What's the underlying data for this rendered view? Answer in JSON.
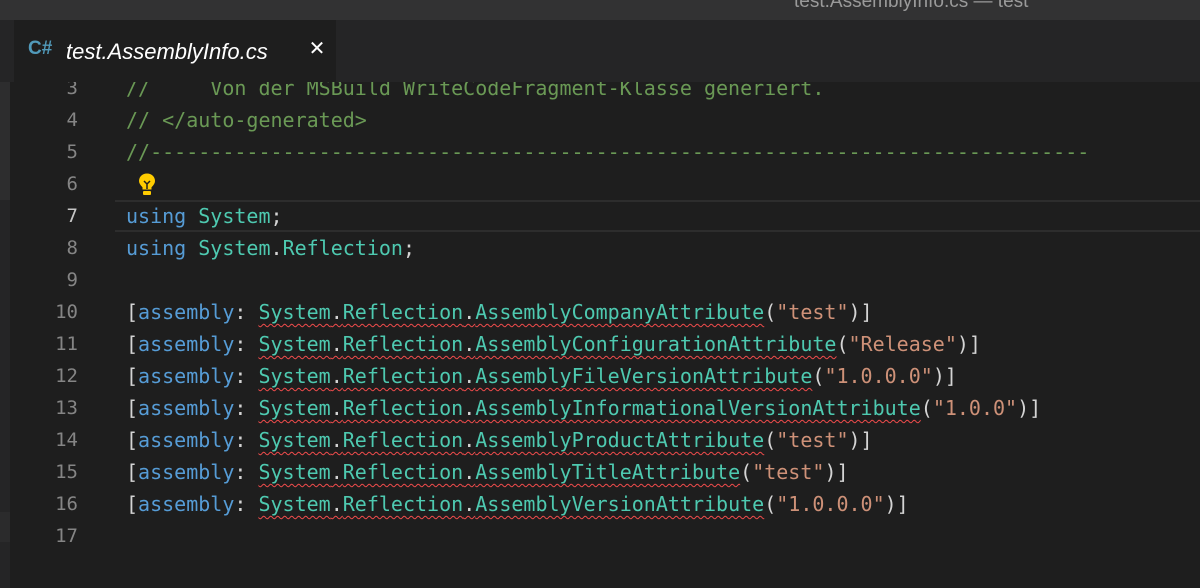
{
  "window": {
    "title": "test.AssemblyInfo.cs — test"
  },
  "tab": {
    "language_icon": "C#",
    "label": "test.AssemblyInfo.cs",
    "close_glyph": "✕"
  },
  "editor": {
    "current_line": 7,
    "lightbulb_line": 6,
    "lines": [
      {
        "num": "3",
        "text": "//     Von der MSBuild WriteCodeFragment-Klasse generiert."
      },
      {
        "num": "4",
        "text": "// </auto-generated>"
      },
      {
        "num": "5",
        "text": "//------------------------------------------------------------------------------"
      },
      {
        "num": "6",
        "text": ""
      },
      {
        "num": "7",
        "text": "using System;"
      },
      {
        "num": "8",
        "text": "using System.Reflection;"
      },
      {
        "num": "9",
        "text": ""
      },
      {
        "num": "10",
        "text": "[assembly: System.Reflection.AssemblyCompanyAttribute(\"test\")]"
      },
      {
        "num": "11",
        "text": "[assembly: System.Reflection.AssemblyConfigurationAttribute(\"Release\")]"
      },
      {
        "num": "12",
        "text": "[assembly: System.Reflection.AssemblyFileVersionAttribute(\"1.0.0.0\")]"
      },
      {
        "num": "13",
        "text": "[assembly: System.Reflection.AssemblyInformationalVersionAttribute(\"1.0.0\")]"
      },
      {
        "num": "14",
        "text": "[assembly: System.Reflection.AssemblyProductAttribute(\"test\")]"
      },
      {
        "num": "15",
        "text": "[assembly: System.Reflection.AssemblyTitleAttribute(\"test\")]"
      },
      {
        "num": "16",
        "text": "[assembly: System.Reflection.AssemblyVersionAttribute(\"1.0.0.0\")]"
      },
      {
        "num": "17",
        "text": ""
      }
    ]
  },
  "colors": {
    "background": "#1e1e1e",
    "comment": "#6a9955",
    "keyword": "#569cd6",
    "type": "#4ec9b0",
    "string": "#ce9178",
    "error_squiggle": "#f14c4c"
  }
}
